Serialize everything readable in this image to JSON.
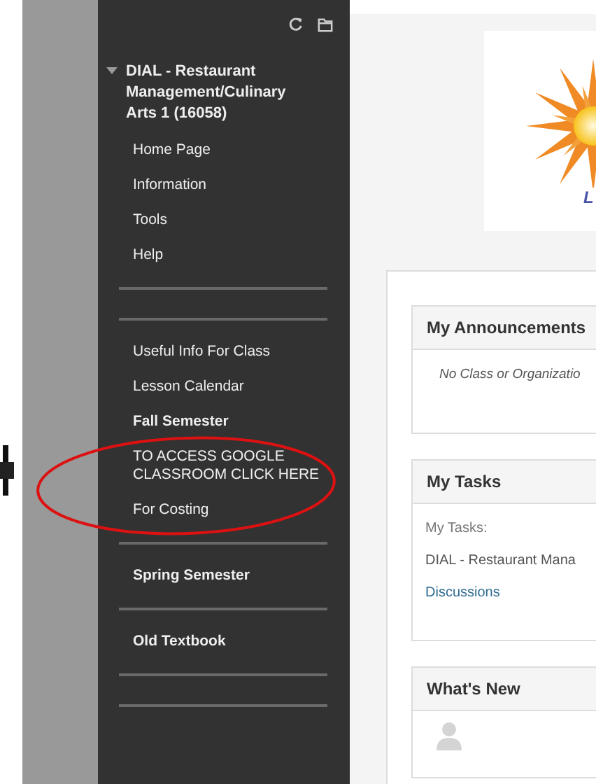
{
  "course_menu": {
    "title": "DIAL - Restaurant Management/Culinary Arts 1 (16058)",
    "expanded": true,
    "items": [
      {
        "kind": "link",
        "label": "Home Page"
      },
      {
        "kind": "link",
        "label": "Information"
      },
      {
        "kind": "link",
        "label": "Tools"
      },
      {
        "kind": "link",
        "label": "Help"
      },
      {
        "kind": "divider"
      },
      {
        "kind": "divider"
      },
      {
        "kind": "link",
        "label": "Useful Info For Class"
      },
      {
        "kind": "link",
        "label": "Lesson Calendar"
      },
      {
        "kind": "heading",
        "label": "Fall Semester"
      },
      {
        "kind": "link",
        "label": "TO ACCESS GOOGLE CLASSROOM CLICK HERE"
      },
      {
        "kind": "link",
        "label": "For Costing"
      },
      {
        "kind": "divider"
      },
      {
        "kind": "heading",
        "label": "Spring Semester"
      },
      {
        "kind": "divider"
      },
      {
        "kind": "heading",
        "label": "Old Textbook"
      },
      {
        "kind": "divider"
      },
      {
        "kind": "divider"
      }
    ]
  },
  "logo": {
    "text": "L"
  },
  "modules": [
    {
      "title": "My Announcements",
      "lines": [
        {
          "kind": "note",
          "text": "No Class or Organizatio"
        }
      ]
    },
    {
      "title": "My Tasks",
      "lines": [
        {
          "kind": "label",
          "text": "My Tasks:"
        },
        {
          "kind": "text",
          "text": "DIAL - Restaurant Mana"
        },
        {
          "kind": "link",
          "text": "Discussions"
        }
      ]
    },
    {
      "title": "What's New",
      "lines": [
        {
          "kind": "avatar"
        }
      ]
    }
  ]
}
